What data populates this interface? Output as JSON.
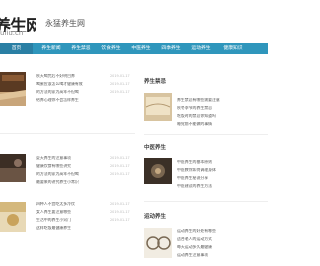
{
  "header": {
    "logo_text": "养生网",
    "logo_domain": "uliu.cn",
    "site_name": "永猛养生网"
  },
  "nav": {
    "items": [
      {
        "label": "首页",
        "active": true
      },
      {
        "label": "养生新闻",
        "active": false
      },
      {
        "label": "养生禁忌",
        "active": false
      },
      {
        "label": "饮食养生",
        "active": false
      },
      {
        "label": "中医养生",
        "active": false
      },
      {
        "label": "四季养生",
        "active": false
      },
      {
        "label": "运动养生",
        "active": false
      },
      {
        "label": "健康知识",
        "active": false
      }
    ]
  },
  "articles": [
    {
      "lines": [
        "秋天喝完后不好明目养",
        "喝蜜应该怎么喝才健康有效",
        "的方法的家为高年不但喝",
        "给养心理你不会怎样养生"
      ],
      "dates": [
        "2019-01-17",
        "2019-01-17",
        "2019-01-17"
      ]
    },
    {
      "lines": [
        "夏天养生的注意事项",
        "健康饮食有哪些讲究",
        "的方法的家为高年不但喝",
        "最要来的讲究养生小常识"
      ],
      "dates": [
        "2019-01-17",
        "2019-01-17",
        "2019-01-17"
      ]
    },
    {
      "lines": [
        "四种人不宜吃太多冷饮",
        "女人养生要注意哪些",
        "生活中的养生小窍门",
        "这样吃饭最健康养生"
      ],
      "dates": [
        "2019-01-17",
        "2019-01-17",
        "2019-01-17"
      ]
    }
  ],
  "sidebar": {
    "sections": [
      {
        "title": "养生禁忌",
        "lines": [
          "养生禁忌有哪些需要注意",
          "秋冬季节的养生禁忌",
          "吃饭时的禁忌你知道吗",
          "睡觉前不能做的事情"
        ]
      },
      {
        "title": "中医养生",
        "lines": [
          "中医养生的基本原则",
          "中医教你如何调理身体",
          "中医养生秘诀分享",
          "中医建议的养生方法"
        ]
      },
      {
        "title": "运动养生",
        "lines": [
          "运动养生的好处有哪些",
          "适合老人的运动方式",
          "每天运动多久最健康",
          "运动养生注意事项"
        ]
      }
    ]
  },
  "colors": {
    "nav_bg": "#2f96bc",
    "nav_active": "#2a7fa4"
  }
}
